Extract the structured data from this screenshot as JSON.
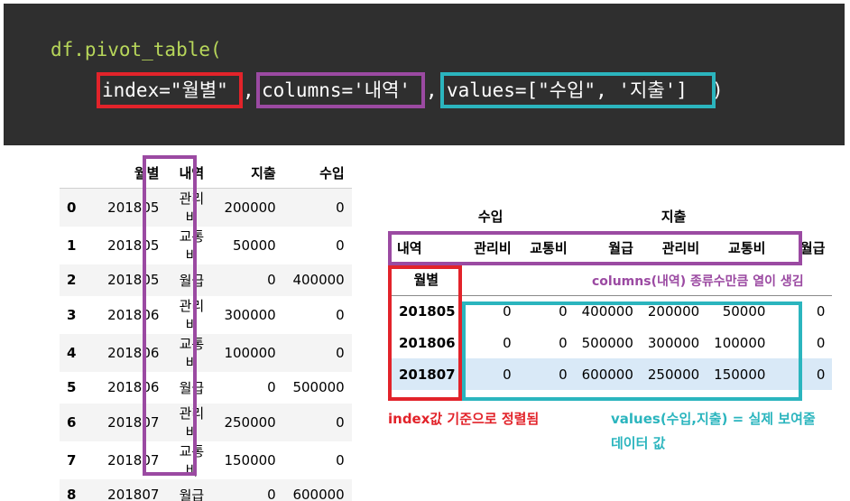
{
  "code": {
    "line1_func": "df.pivot_table(",
    "line2_index": "index=\"월별\"",
    "line2_sep1": ",",
    "line2_columns": "columns='내역'",
    "line2_sep2": ",",
    "line2_values": "values=[\"수입\", '지출']",
    "line2_close": ")"
  },
  "table1": {
    "headers": [
      "",
      "월별",
      "내역",
      "지출",
      "수입"
    ],
    "rows": [
      [
        "0",
        "201805",
        "관리비",
        "200000",
        "0"
      ],
      [
        "1",
        "201805",
        "교통비",
        "50000",
        "0"
      ],
      [
        "2",
        "201805",
        "월급",
        "0",
        "400000"
      ],
      [
        "3",
        "201806",
        "관리비",
        "300000",
        "0"
      ],
      [
        "4",
        "201806",
        "교통비",
        "100000",
        "0"
      ],
      [
        "5",
        "201806",
        "월급",
        "0",
        "500000"
      ],
      [
        "6",
        "201807",
        "관리비",
        "250000",
        "0"
      ],
      [
        "7",
        "201807",
        "교통비",
        "150000",
        "0"
      ],
      [
        "8",
        "201807",
        "월급",
        "0",
        "600000"
      ]
    ]
  },
  "table2": {
    "top_headers": [
      "수입",
      "지출"
    ],
    "sub_headers": [
      "내역",
      "관리비",
      "교통비",
      "월급",
      "관리비",
      "교통비",
      "월급"
    ],
    "index_name": "월별",
    "rows": [
      [
        "201805",
        "0",
        "0",
        "400000",
        "200000",
        "50000",
        "0"
      ],
      [
        "201806",
        "0",
        "0",
        "500000",
        "300000",
        "100000",
        "0"
      ],
      [
        "201807",
        "0",
        "0",
        "600000",
        "250000",
        "150000",
        "0"
      ]
    ]
  },
  "annotations": {
    "columns_note": "columns(내역) 종류수만큼 열이 생김",
    "index_note": "index값 기준으로 정렬됨",
    "values_note_line1": "values(수입,지출) = 실제 보여줄",
    "values_note_line2": "데이터 값"
  },
  "colors": {
    "code_bg": "#2f2f2f",
    "red_box": "#e2232a",
    "purple_box": "#9b4aa2",
    "teal_box": "#2bb5be",
    "func_green": "#b7d65a",
    "row_highlight": "#d9e9f7"
  }
}
